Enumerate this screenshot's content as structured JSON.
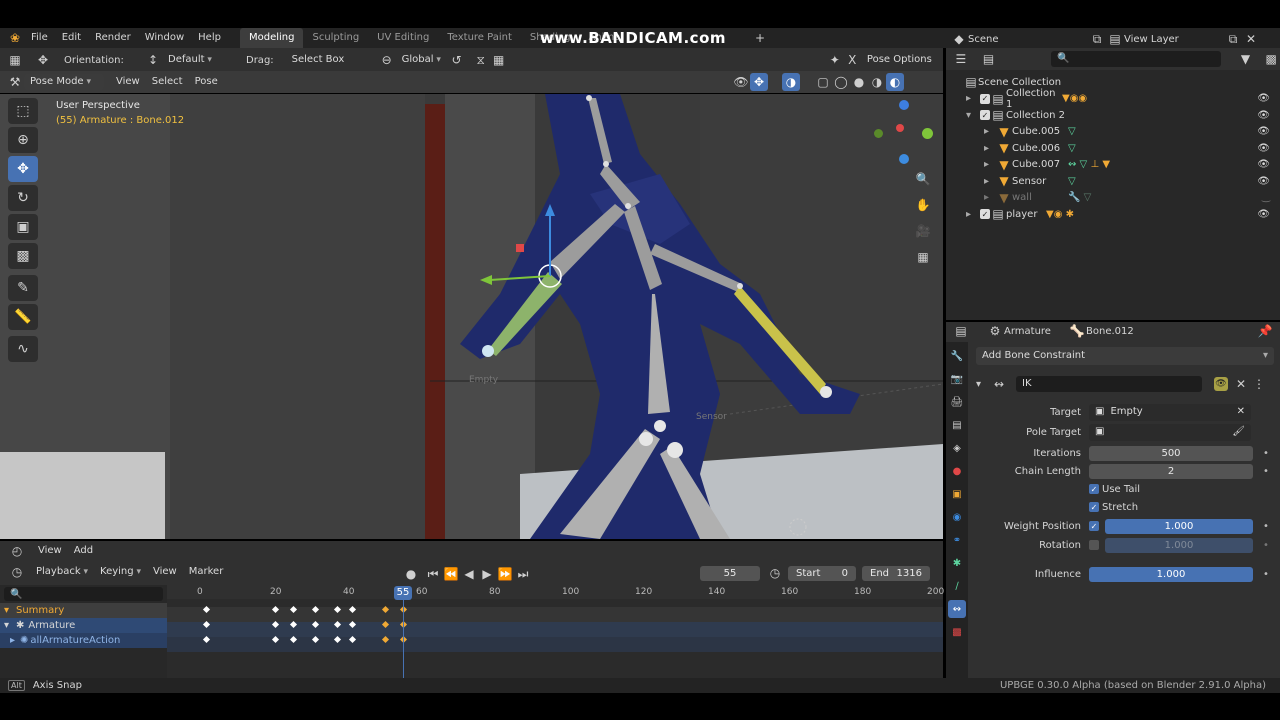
{
  "topbar": {
    "menus": [
      "File",
      "Edit",
      "Render",
      "Window",
      "Help"
    ],
    "workspaces": [
      "Modeling",
      "Sculpting",
      "UV Editing",
      "Texture Paint",
      "Shading",
      "Anima"
    ],
    "active_workspace": "Modeling",
    "watermark": "www.BANDICAM.com",
    "scene": "Scene",
    "view_layer": "View Layer"
  },
  "viewport_header": {
    "orientation_label": "Orientation:",
    "orientation_value": "Default",
    "drag_label": "Drag:",
    "drag_value": "Select Box",
    "transform_orientation": "Global",
    "pose_options": "Pose Options",
    "mode": "Pose Mode",
    "menus": [
      "View",
      "Select",
      "Pose"
    ]
  },
  "viewport": {
    "perspective": "User Perspective",
    "active_info": "(55) Armature : Bone.012",
    "empty_label": "Empty",
    "sensor_label": "Sensor"
  },
  "outliner": {
    "root": "Scene Collection",
    "items": [
      {
        "name": "Collection 1"
      },
      {
        "name": "Collection 2"
      },
      {
        "name": "Cube.005"
      },
      {
        "name": "Cube.006"
      },
      {
        "name": "Cube.007"
      },
      {
        "name": "Sensor"
      },
      {
        "name": "wall"
      },
      {
        "name": "player"
      }
    ]
  },
  "properties": {
    "breadcrumb_object": "Armature",
    "breadcrumb_bone": "Bone.012",
    "add_constraint": "Add Bone Constraint",
    "constraint_name": "IK",
    "target_label": "Target",
    "target_value": "Empty",
    "pole_target_label": "Pole Target",
    "iterations_label": "Iterations",
    "iterations_value": "500",
    "chain_length_label": "Chain Length",
    "chain_length_value": "2",
    "use_tail": "Use Tail",
    "stretch": "Stretch",
    "weight_position_label": "Weight Position",
    "weight_position_value": "1.000",
    "rotation_label": "Rotation",
    "rotation_value": "1.000",
    "influence_label": "Influence",
    "influence_value": "1.000"
  },
  "timeline": {
    "menus": [
      "View",
      "Add"
    ],
    "playback": "Playback",
    "keying": "Keying",
    "view": "View",
    "marker": "Marker",
    "current_frame": "55",
    "start_label": "Start",
    "start_value": "0",
    "end_label": "End",
    "end_value": "1316",
    "ruler": [
      "0",
      "20",
      "40",
      "60",
      "80",
      "100",
      "120",
      "140",
      "160",
      "180",
      "200"
    ],
    "channels": [
      "Summary",
      "Armature",
      "allArmatureAction"
    ]
  },
  "statusbar": {
    "alt_key": "Alt",
    "hint": "Axis Snap",
    "version": "UPBGE 0.30.0 Alpha (based on Blender 2.91.0 Alpha)"
  },
  "colors": {
    "accent": "#4772b3",
    "keyframe_selected": "#f0a935",
    "current_frame": "#4772b3"
  }
}
